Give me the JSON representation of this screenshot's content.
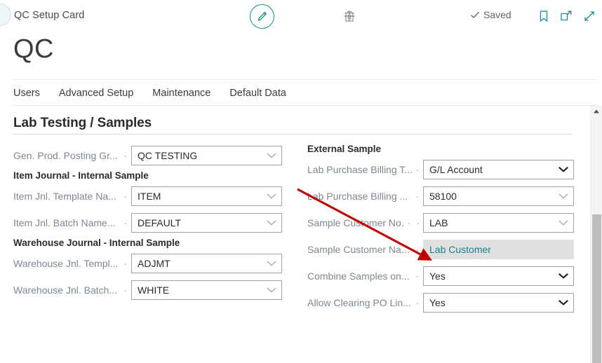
{
  "window": {
    "card_name": "QC Setup Card",
    "page_title": "QC",
    "accent_color": "#1a8a99",
    "readonly_field_bg": "#e0e0e0",
    "readonly_text_color": "#1a7f8e",
    "annotation_arrow_color": "#c00000"
  },
  "toolbar": {
    "edit_icon": "pencil-icon",
    "new_label": "+",
    "new_icon": "plus-icon",
    "delete_icon": "trash-icon",
    "saved_label": "Saved",
    "saved_icon": "check-icon",
    "bookmark_icon": "bookmark-icon",
    "open_in_new_window_icon": "open-in-new-window-icon",
    "expand_icon": "expand-diagonal-icon",
    "back_icon": "back-circle-icon"
  },
  "nav": {
    "items": [
      {
        "label": "Users"
      },
      {
        "label": "Advanced Setup"
      },
      {
        "label": "Maintenance"
      },
      {
        "label": "Default Data"
      }
    ]
  },
  "group": {
    "title": "Lab Testing / Samples"
  },
  "left_column": [
    {
      "kind": "field",
      "label": "Gen. Prod. Posting Gr...",
      "dots": "·",
      "value": "QC TESTING",
      "control": "lookup",
      "name": "gen-prod-posting-group-field"
    },
    {
      "kind": "subhead",
      "label": "Item Journal - Internal Sample",
      "name": "item-journal-internal-sample-subheading"
    },
    {
      "kind": "field",
      "label": "Item Jnl. Template Na...",
      "dots": "·",
      "value": "ITEM",
      "control": "lookup",
      "name": "item-jnl-template-name-field"
    },
    {
      "kind": "field",
      "label": "Item Jnl. Batch Name...",
      "dots": "·",
      "value": "DEFAULT",
      "control": "lookup",
      "name": "item-jnl-batch-name-field"
    },
    {
      "kind": "subhead",
      "label": "Warehouse Journal - Internal Sample",
      "name": "warehouse-journal-internal-sample-subheading"
    },
    {
      "kind": "field",
      "label": "Warehouse Jnl. Templ...",
      "dots": "·",
      "value": "ADJMT",
      "control": "lookup",
      "name": "warehouse-jnl-template-field"
    },
    {
      "kind": "field",
      "label": "Warehouse Jnl. Batch...",
      "dots": "·",
      "value": "WHITE",
      "control": "lookup",
      "name": "warehouse-jnl-batch-field"
    }
  ],
  "right_column": [
    {
      "kind": "subhead",
      "label": "External Sample",
      "name": "external-sample-subheading"
    },
    {
      "kind": "field",
      "label": "Lab Purchase Billing T...",
      "dots": "·",
      "value": "G/L Account",
      "control": "select",
      "name": "lab-purchase-billing-type-field"
    },
    {
      "kind": "field",
      "label": "Lab Purchase Billing ...",
      "dots": "·",
      "value": "58100",
      "control": "lookup",
      "name": "lab-purchase-billing-no-field"
    },
    {
      "kind": "field",
      "label": "Sample Customer No.",
      "dots": "· ·",
      "value": "LAB",
      "control": "lookup",
      "name": "sample-customer-no-field"
    },
    {
      "kind": "field",
      "label": "Sample Customer Na...",
      "dots": "·",
      "value": "Lab Customer",
      "control": "readonly",
      "name": "sample-customer-name-field"
    },
    {
      "kind": "field",
      "label": "Combine Samples on...",
      "dots": "·",
      "value": "Yes",
      "control": "select",
      "name": "combine-samples-on-field"
    },
    {
      "kind": "field",
      "label": "Allow Clearing PO Lin...",
      "dots": "·",
      "value": "Yes",
      "control": "select",
      "name": "allow-clearing-po-lines-field"
    }
  ],
  "scrollbar": {
    "up_arrow_icon": "scroll-up-arrow-icon",
    "thumb": "scroll-thumb"
  }
}
